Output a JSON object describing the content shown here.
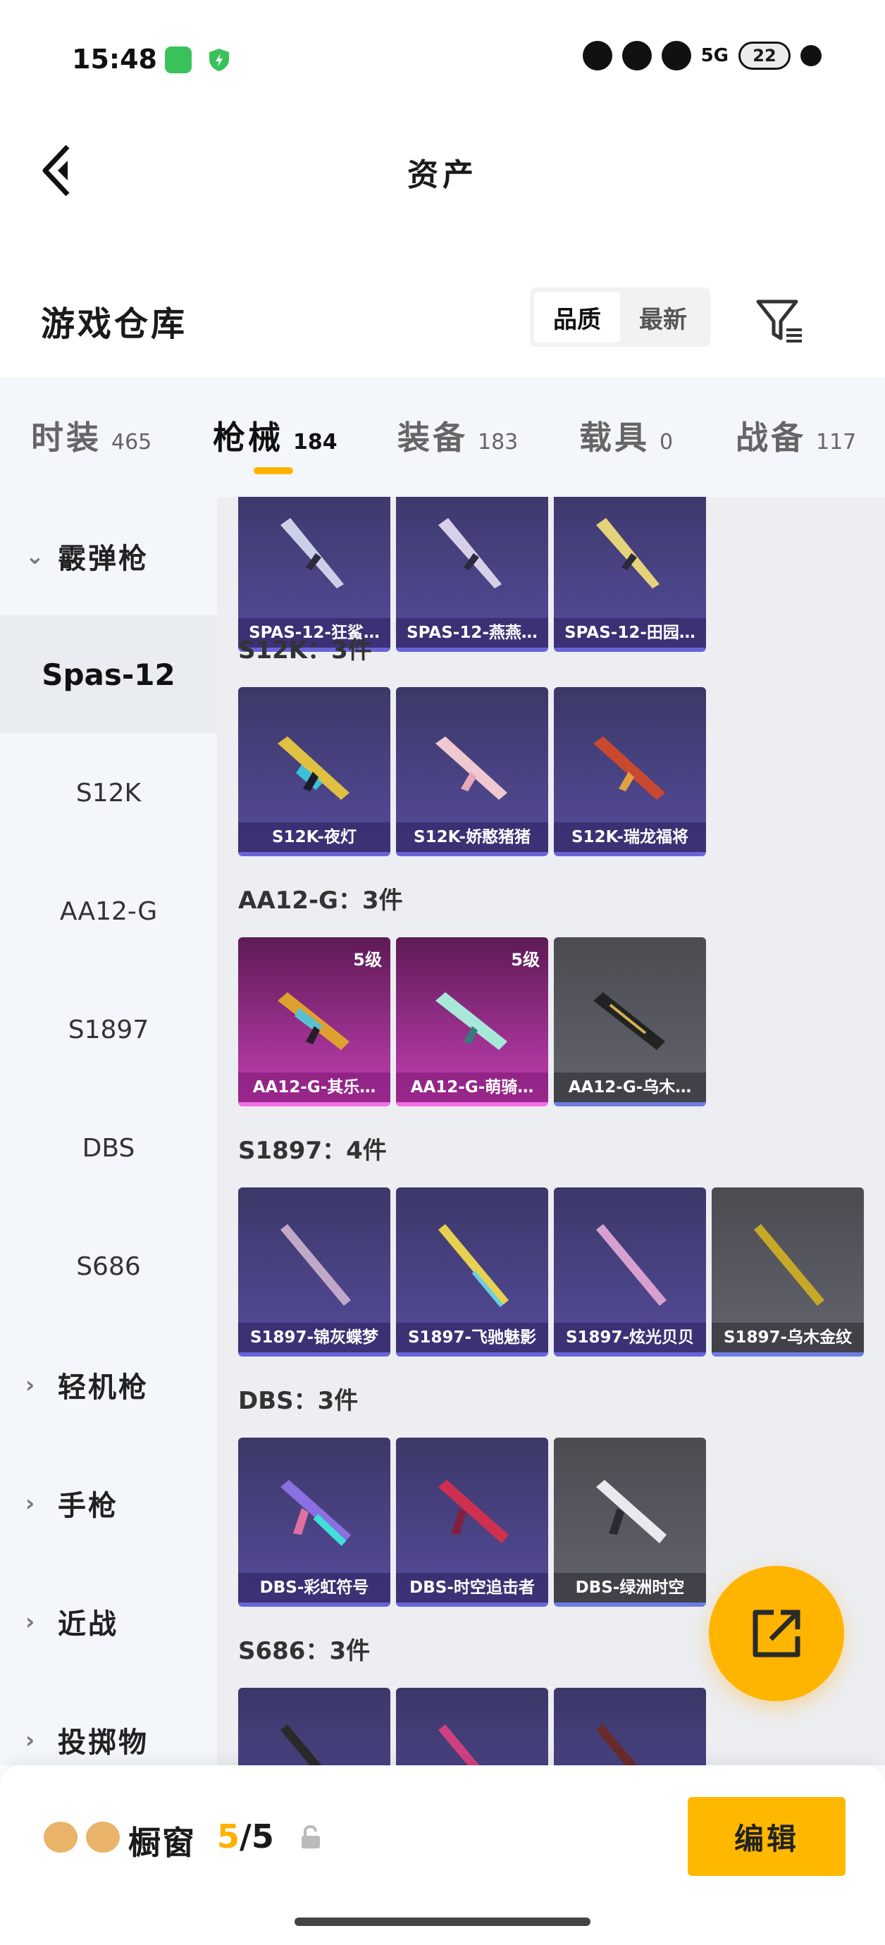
{
  "status_bar": {
    "time": "15:48",
    "network": "5G",
    "battery": "22"
  },
  "header": {
    "title": "资产"
  },
  "section": {
    "title": "游戏仓库"
  },
  "sort": {
    "options": [
      "品质",
      "最新"
    ],
    "active": "品质"
  },
  "tabs": [
    {
      "label": "时装",
      "count": "465"
    },
    {
      "label": "枪械",
      "count": "184",
      "active": true
    },
    {
      "label": "装备",
      "count": "183"
    },
    {
      "label": "载具",
      "count": "0"
    },
    {
      "label": "战备",
      "count": "117"
    }
  ],
  "sidebar": {
    "groups": [
      "霰弹枪",
      "轻机枪",
      "手枪",
      "近战",
      "投掷物"
    ],
    "subitems": [
      "Spas-12",
      "S12K",
      "AA12-G",
      "S1897",
      "DBS",
      "S686"
    ],
    "active": "Spas-12"
  },
  "groups": [
    {
      "title": "",
      "items": [
        {
          "name": "SPAS-12-狂鲨…",
          "style": "purple"
        },
        {
          "name": "SPAS-12-燕燕…",
          "style": "purple"
        },
        {
          "name": "SPAS-12-田园…",
          "style": "purple"
        }
      ]
    },
    {
      "title": "S12K：3件",
      "items": [
        {
          "name": "S12K-夜灯",
          "style": "purple"
        },
        {
          "name": "S12K-娇憨猪猪",
          "style": "purple"
        },
        {
          "name": "S12K-瑞龙福将",
          "style": "purple"
        }
      ]
    },
    {
      "title": "AA12-G：3件",
      "items": [
        {
          "name": "AA12-G-其乐…",
          "style": "pink",
          "level": "5级"
        },
        {
          "name": "AA12-G-萌骑…",
          "style": "pink",
          "level": "5级"
        },
        {
          "name": "AA12-G-乌木…",
          "style": "gray"
        }
      ]
    },
    {
      "title": "S1897：4件",
      "items": [
        {
          "name": "S1897-锦灰蝶梦",
          "style": "purple"
        },
        {
          "name": "S1897-飞驰魅影",
          "style": "purple"
        },
        {
          "name": "S1897-炫光贝贝",
          "style": "purple"
        },
        {
          "name": "S1897-乌木金纹",
          "style": "gray"
        }
      ]
    },
    {
      "title": "DBS：3件",
      "items": [
        {
          "name": "DBS-彩虹符号",
          "style": "purple"
        },
        {
          "name": "DBS-时空追击者",
          "style": "purple"
        },
        {
          "name": "DBS-绿洲时空",
          "style": "gray"
        }
      ]
    },
    {
      "title": "S686：3件",
      "items": [
        {
          "name": "",
          "style": "purple"
        },
        {
          "name": "",
          "style": "purple"
        },
        {
          "name": "",
          "style": "purple"
        }
      ]
    }
  ],
  "bottom": {
    "showcase_label": "橱窗",
    "showcase_current": "5",
    "showcase_sep": "/",
    "showcase_total": "5",
    "edit_label": "编辑"
  },
  "colors": {
    "accent": "#ffb800",
    "purple_card": "#4a4488",
    "pink_card": "#b0329f",
    "gray_card": "#56575e"
  }
}
